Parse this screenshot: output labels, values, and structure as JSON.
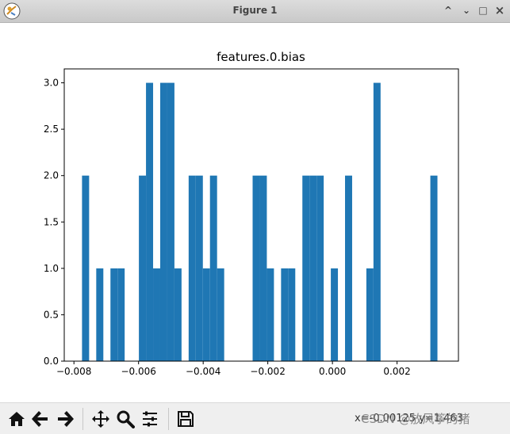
{
  "window": {
    "title": "Figure 1",
    "minimize_label": "^",
    "minimize2_label": "⌄",
    "maximize_label": "□",
    "close_label": "×"
  },
  "toolbar": {
    "coord_text": "x=-0.00125 y=1.463",
    "watermark": "CSDN @放风筝的猪",
    "icons": [
      "home-icon",
      "back-icon",
      "forward-icon",
      "pan-icon",
      "zoom-icon",
      "configure-subplots-icon",
      "save-icon"
    ]
  },
  "colors": {
    "bar": "#1f77b4",
    "axes": "#000000"
  },
  "chart_data": {
    "type": "bar",
    "title": "features.0.bias",
    "xlabel": "",
    "ylabel": "",
    "xlim": [
      -0.0083,
      0.0039
    ],
    "ylim": [
      0,
      3.15
    ],
    "xticks": [
      -0.008,
      -0.006,
      -0.004,
      -0.002,
      0.0,
      0.002
    ],
    "xtick_labels": [
      "−0.008",
      "−0.006",
      "−0.004",
      "−0.002",
      "0.000",
      "0.002"
    ],
    "yticks": [
      0.0,
      0.5,
      1.0,
      1.5,
      2.0,
      2.5,
      3.0
    ],
    "ytick_labels": [
      "0.0",
      "0.5",
      "1.0",
      "1.5",
      "2.0",
      "2.5",
      "3.0"
    ],
    "grid": false,
    "bins": [
      {
        "x0": -0.00775,
        "x1": -0.00753,
        "value": 2
      },
      {
        "x0": -0.00731,
        "x1": -0.00709,
        "value": 1
      },
      {
        "x0": -0.00687,
        "x1": -0.00665,
        "value": 1
      },
      {
        "x0": -0.00665,
        "x1": -0.00643,
        "value": 1
      },
      {
        "x0": -0.00599,
        "x1": -0.00577,
        "value": 2
      },
      {
        "x0": -0.00577,
        "x1": -0.00555,
        "value": 3
      },
      {
        "x0": -0.00555,
        "x1": -0.00533,
        "value": 1
      },
      {
        "x0": -0.00533,
        "x1": -0.00511,
        "value": 3
      },
      {
        "x0": -0.00511,
        "x1": -0.00489,
        "value": 3
      },
      {
        "x0": -0.00489,
        "x1": -0.00467,
        "value": 1
      },
      {
        "x0": -0.00445,
        "x1": -0.00423,
        "value": 2
      },
      {
        "x0": -0.00423,
        "x1": -0.00401,
        "value": 2
      },
      {
        "x0": -0.00401,
        "x1": -0.00379,
        "value": 1
      },
      {
        "x0": -0.00379,
        "x1": -0.00357,
        "value": 2
      },
      {
        "x0": -0.00357,
        "x1": -0.00335,
        "value": 1
      },
      {
        "x0": -0.00247,
        "x1": -0.00225,
        "value": 2
      },
      {
        "x0": -0.00225,
        "x1": -0.00203,
        "value": 2
      },
      {
        "x0": -0.00203,
        "x1": -0.00181,
        "value": 1
      },
      {
        "x0": -0.00159,
        "x1": -0.00137,
        "value": 1
      },
      {
        "x0": -0.00137,
        "x1": -0.00115,
        "value": 1
      },
      {
        "x0": -0.00093,
        "x1": -0.00071,
        "value": 2
      },
      {
        "x0": -0.00071,
        "x1": -0.00049,
        "value": 2
      },
      {
        "x0": -0.00049,
        "x1": -0.00027,
        "value": 2
      },
      {
        "x0": -5e-05,
        "x1": 0.00017,
        "value": 1
      },
      {
        "x0": 0.00039,
        "x1": 0.00061,
        "value": 2
      },
      {
        "x0": 0.00105,
        "x1": 0.00127,
        "value": 1
      },
      {
        "x0": 0.00127,
        "x1": 0.00149,
        "value": 3
      },
      {
        "x0": 0.00303,
        "x1": 0.00325,
        "value": 2
      }
    ]
  }
}
